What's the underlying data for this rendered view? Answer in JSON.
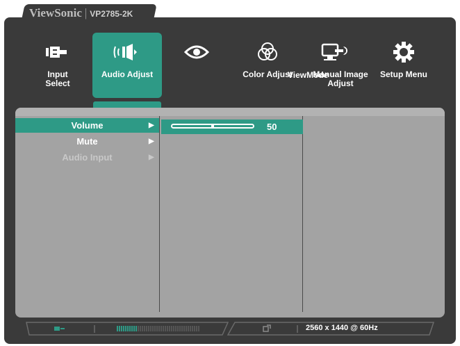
{
  "brand": {
    "name": "ViewSonic",
    "separator": "|",
    "model": "VP2785-2K"
  },
  "tabs": [
    {
      "label": "Input\nSelect",
      "icon": "input-select-icon",
      "active": false
    },
    {
      "label": "Audio Adjust",
      "icon": "speaker-icon",
      "active": true
    },
    {
      "label": "",
      "icon": "eye-icon",
      "active": false
    },
    {
      "label": "Color Adjust",
      "icon": "color-circles-icon",
      "active": false
    },
    {
      "label": "ViewMode",
      "icon": "",
      "active": false
    },
    {
      "label": "Manual Image\nAdjust",
      "icon": "monitor-wrench-icon",
      "active": false
    },
    {
      "label": "Setup Menu",
      "icon": "gear-icon",
      "active": false
    }
  ],
  "menu": {
    "items": [
      {
        "label": "Volume",
        "state": "selected"
      },
      {
        "label": "Mute",
        "state": "normal"
      },
      {
        "label": "Audio Input",
        "state": "disabled"
      }
    ],
    "arrow": "▶"
  },
  "volume": {
    "value": "50",
    "level": 0.5
  },
  "status": {
    "resolution": "2560 x 1440 @ 60Hz"
  },
  "colors": {
    "accent": "#2e9a86",
    "frame": "#3a3a3a",
    "panel": "#a3a3a3"
  }
}
